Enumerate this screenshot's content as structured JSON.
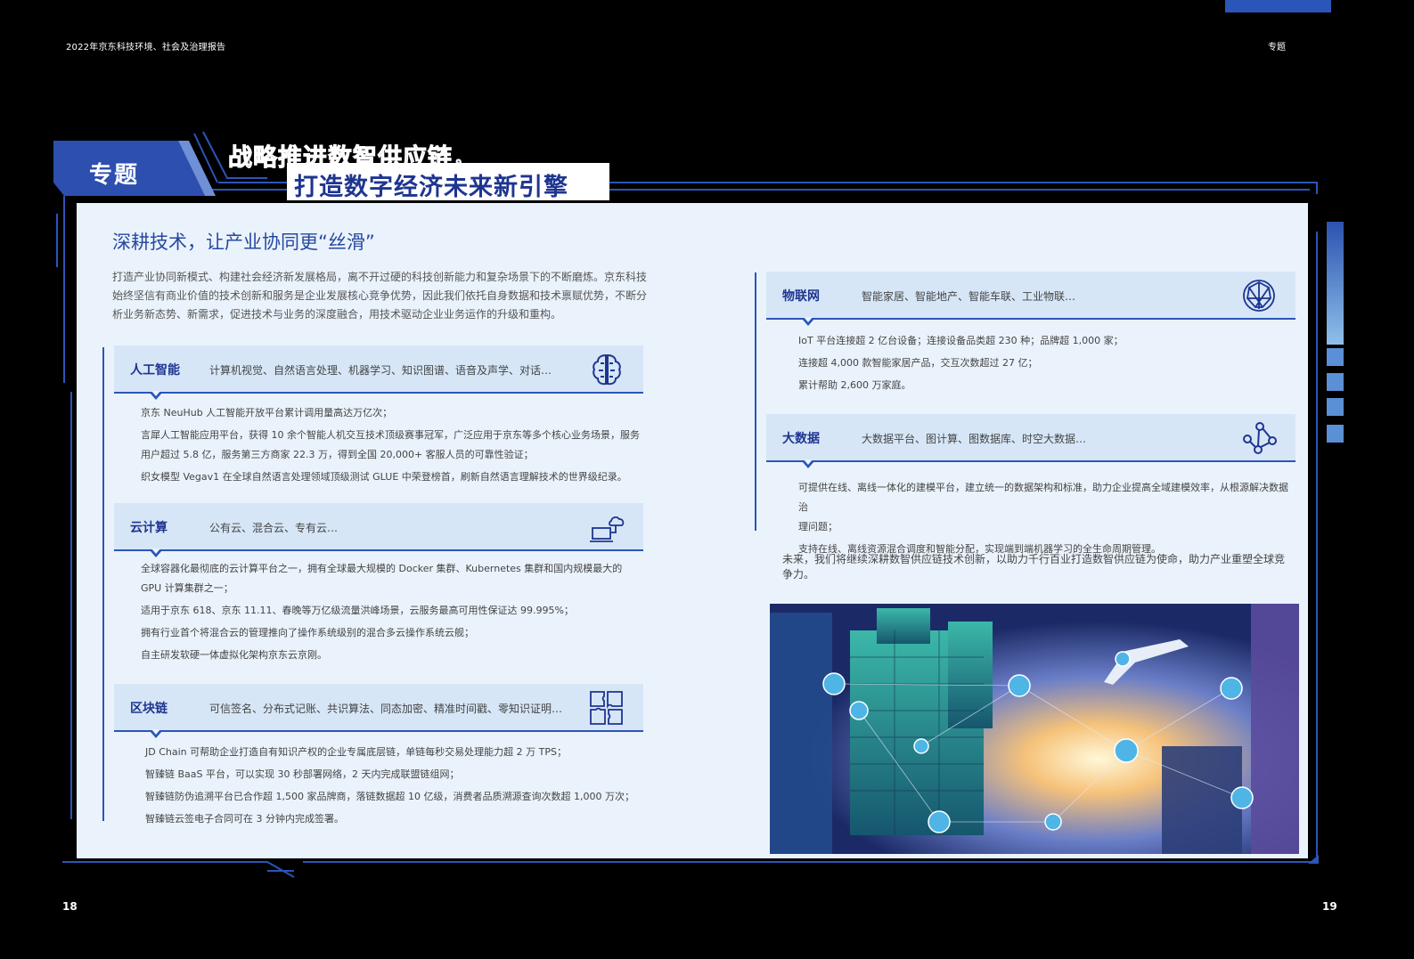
{
  "header": {
    "report_title": "2022年京东科技环境、社会及治理报告",
    "section_tag": "专题"
  },
  "page_numbers": {
    "left": "18",
    "right": "19"
  },
  "topic": {
    "badge": "专题",
    "title_line1": "战略推进数智供应链，",
    "title_line2": "打造数字经济未来新引擎"
  },
  "section": {
    "heading": "深耕技术，让产业协同更“丝滑”",
    "intro": "打造产业协同新模式、构建社会经济新发展格局，离不开过硬的科技创新能力和复杂场景下的不断磨炼。京东科技始终坚信有商业价值的技术创新和服务是企业发展核心竞争优势，因此我们依托自身数据和技术禀赋优势，不断分析业务新态势、新需求，促进技术与业务的深度融合，用技术驱动企业业务运作的升级和重构。"
  },
  "cards": {
    "ai": {
      "title": "人工智能",
      "subtitle": "计算机视觉、自然语言处理、机器学习、知识图谱、语音及声学、对话…",
      "icon": "brain-circuit-icon",
      "bullets": [
        "京东 NeuHub 人工智能开放平台累计调用量高达万亿次；",
        "言犀人工智能应用平台，获得 10 余个智能人机交互技术顶级赛事冠军，广泛应用于京东等多个核心业务场景，服务",
        "用户超过 5.8 亿，服务第三方商家 22.3 万，得到全国 20,000+ 客服人员的可靠性验证；",
        "织女模型 Vegav1 在全球自然语言处理领域顶级测试 GLUE 中荣登榜首，刷新自然语言理解技术的世界级纪录。"
      ]
    },
    "cloud": {
      "title": "云计算",
      "subtitle": "公有云、混合云、专有云…",
      "icon": "cloud-laptop-icon",
      "bullets": [
        "全球容器化最彻底的云计算平台之一，拥有全球最大规模的 Docker 集群、Kubernetes 集群和国内规模最大的",
        "GPU 计算集群之一；",
        "适用于京东 618、京东 11.11、春晚等万亿级流量洪峰场景，云服务最高可用性保证达 99.995%；",
        "拥有行业首个将混合云的管理推向了操作系统级别的混合多云操作系统云舰；",
        "自主研发软硬一体虚拟化架构京东云京刚。"
      ]
    },
    "blockchain": {
      "title": "区块链",
      "subtitle": "可信签名、分布式记账、共识算法、同态加密、精准时间戳、零知识证明…",
      "icon": "puzzle-icon",
      "bullets": [
        "JD Chain 可帮助企业打造自有知识产权的企业专属底层链，单链每秒交易处理能力超 2 万 TPS；",
        "智臻链 BaaS 平台，可以实现 30 秒部署网络，2 天内完成联盟链组网；",
        "智臻链防伪追溯平台已合作超 1,500 家品牌商，落链数据超 10 亿级，消费者品质溯源查询次数超 1,000 万次；",
        "智臻链云签电子合同可在 3 分钟内完成签署。"
      ]
    },
    "iot": {
      "title": "物联网",
      "subtitle": "智能家居、智能地产、智能车联、工业物联…",
      "icon": "globe-network-icon",
      "bullets": [
        "IoT 平台连接超 2 亿台设备；连接设备品类超 230 种；品牌超 1,000 家；",
        "连接超 4,000 款智能家居产品，交互次数超过 27 亿；",
        "累计帮助 2,600 万家庭。"
      ]
    },
    "bigdata": {
      "title": "大数据",
      "subtitle": "大数据平台、图计算、图数据库、时空大数据…",
      "icon": "data-graph-icon",
      "bullets": [
        "可提供在线、离线一体化的建模平台，建立统一的数据架构和标准，助力企业提高全域建模效率，从根源解决数据治",
        "理问题；",
        "支持在线、离线资源混合调度和智能分配，实现端到端机器学习的全生命周期管理。"
      ]
    }
  },
  "closing": "未来，我们将继续深耕数智供应链技术创新，以助力千行百业打造数智供应链为使命，助力产业重塑全球竞争力。",
  "photo": {
    "subject": "shipping containers with airplane and network icons",
    "icon": "logistics-photo"
  },
  "colors": {
    "brand_blue": "#2b55b8",
    "dark_blue": "#1e3590",
    "panel_bg": "#eaf3fc",
    "band_bg": "#d6e6f7"
  }
}
